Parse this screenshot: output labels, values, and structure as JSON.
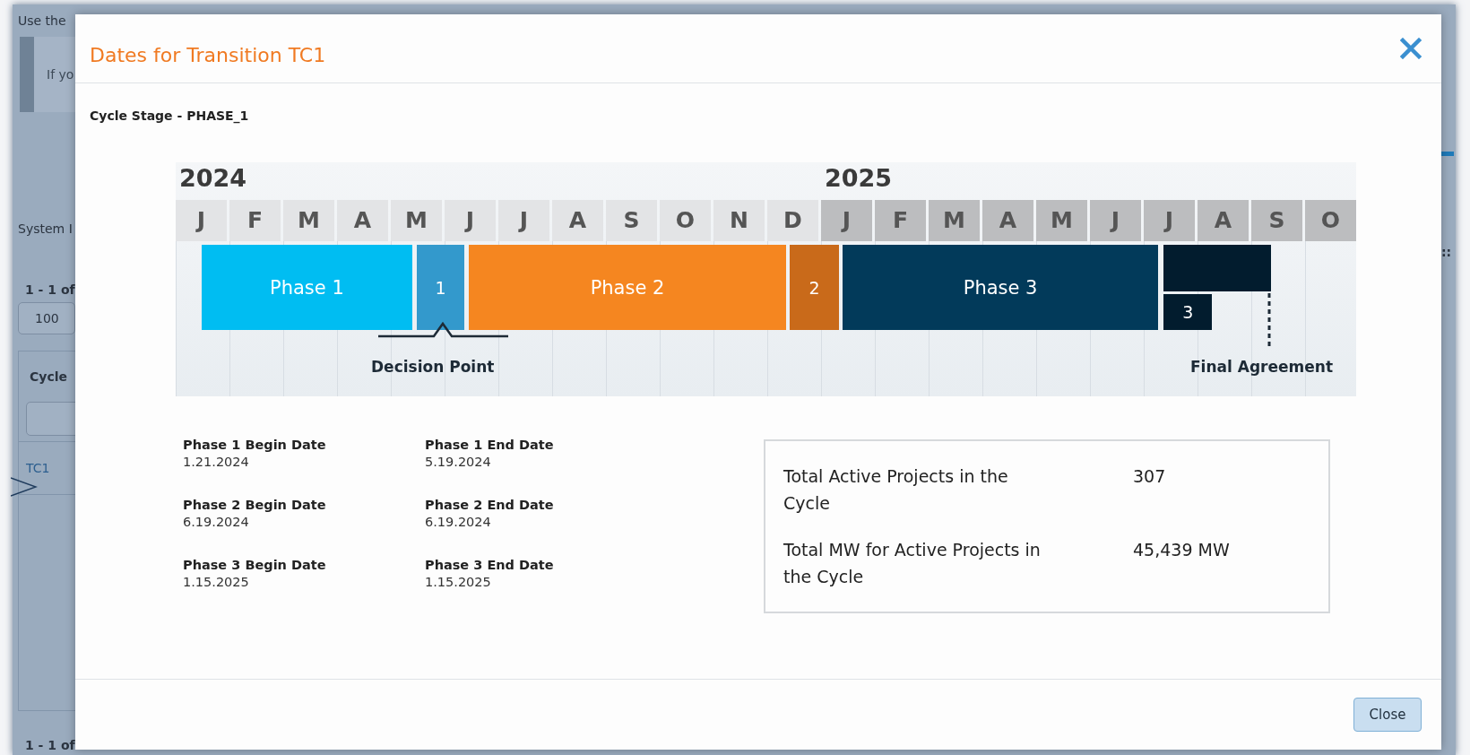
{
  "background": {
    "intro_text": "Use the",
    "notice_text": "If yo",
    "section_label": "System I",
    "pager_top": "1 - 1 of",
    "page_size": "100",
    "column_header": "Cycle",
    "link": "TC1",
    "pager_bottom": "1 - 1 of",
    "edge_text": "::"
  },
  "dialog": {
    "title": "Dates for Transition TC1",
    "stage": "Cycle Stage - PHASE_1",
    "timeline": {
      "years": [
        {
          "label": "2024",
          "months": [
            "J",
            "F",
            "M",
            "A",
            "M",
            "J",
            "J",
            "A",
            "S",
            "O",
            "N",
            "D"
          ]
        },
        {
          "label": "2025",
          "months": [
            "J",
            "F",
            "M",
            "A",
            "M",
            "J",
            "J",
            "A",
            "S",
            "O"
          ]
        }
      ],
      "bars": [
        {
          "label": "Phase 1",
          "kind": "phase",
          "color": "#00bdf2"
        },
        {
          "label": "1",
          "kind": "gate",
          "color": "#3399cc"
        },
        {
          "label": "Phase 2",
          "kind": "phase",
          "color": "#f58620"
        },
        {
          "label": "2",
          "kind": "gate",
          "color": "#c96a1a"
        },
        {
          "label": "Phase 3",
          "kind": "phase",
          "color": "#023a5a"
        },
        {
          "label": "3",
          "kind": "gate",
          "color": "#021c2e"
        }
      ],
      "markers": [
        {
          "label": "Decision Point",
          "kind": "bracket"
        },
        {
          "label": "Final Agreement",
          "kind": "dotted"
        }
      ]
    },
    "dates": [
      {
        "label": "Phase 1 Begin Date",
        "value": "1.21.2024"
      },
      {
        "label": "Phase 1 End Date",
        "value": "5.19.2024"
      },
      {
        "label": "Phase 2 Begin Date",
        "value": "6.19.2024"
      },
      {
        "label": "Phase 2 End Date",
        "value": "6.19.2024"
      },
      {
        "label": "Phase 3 Begin Date",
        "value": "1.15.2025"
      },
      {
        "label": "Phase 3 End Date",
        "value": "1.15.2025"
      }
    ],
    "summary": [
      {
        "label": "Total Active Projects in the Cycle",
        "value": "307"
      },
      {
        "label": "Total MW for Active Projects in the Cycle",
        "value": "45,439 MW"
      }
    ],
    "close_button": "Close"
  }
}
